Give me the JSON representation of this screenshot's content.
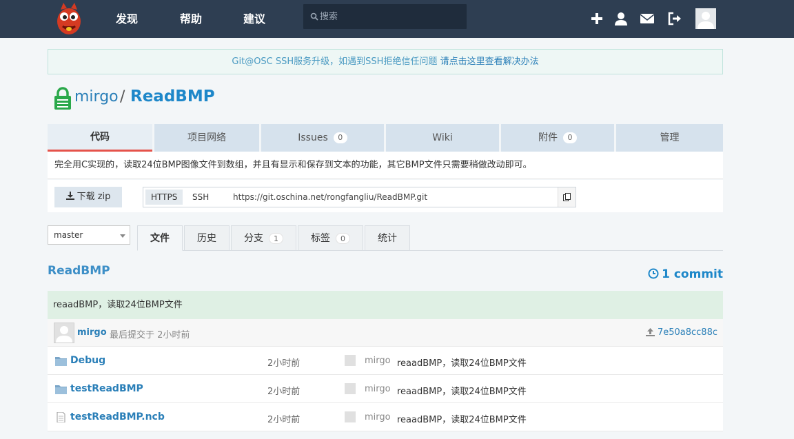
{
  "nav": {
    "links": [
      "发现",
      "帮助",
      "建议"
    ],
    "search_placeholder": "搜索",
    "icons": [
      "plus-icon",
      "user-icon",
      "envelope-icon",
      "logout-icon"
    ]
  },
  "notice": {
    "text": "Git@OSC SSH服务升级，如遇到SSH拒绝信任问题 ",
    "link": "请点击这里查看解决办法"
  },
  "repo": {
    "owner": "mirgo",
    "separator": "/",
    "name": "ReadBMP"
  },
  "tabs": [
    {
      "label": "代码",
      "active": true
    },
    {
      "label": "项目网络"
    },
    {
      "label": "Issues",
      "count": "0"
    },
    {
      "label": "Wiki"
    },
    {
      "label": "附件",
      "count": "0"
    },
    {
      "label": "管理"
    }
  ],
  "description": "完全用C实现的，读取24位BMP图像文件到数组，并且有显示和保存到文本的功能，其它BMP文件只需要稍做改动即可。",
  "download": {
    "label": "下载 zip"
  },
  "clone": {
    "https_label": "HTTPS",
    "ssh_label": "SSH",
    "url": "https://git.oschina.net/rongfangliu/ReadBMP.git"
  },
  "branch": {
    "selected": "master"
  },
  "file_tabs": [
    {
      "label": "文件",
      "active": true
    },
    {
      "label": "历史"
    },
    {
      "label": "分支",
      "count": "1"
    },
    {
      "label": "标签",
      "count": "0"
    },
    {
      "label": "统计"
    }
  ],
  "section": {
    "title": "ReadBMP",
    "commits": "1 commit"
  },
  "last_commit": {
    "message": "reaadBMP，读取24位BMP文件",
    "author": "mirgo",
    "time": "最后提交于 2小时前",
    "sha": "7e50a8cc88c"
  },
  "files": [
    {
      "name": "Debug",
      "type": "folder",
      "time": "2小时前",
      "author": "mirgo",
      "message": "reaadBMP，读取24位BMP文件"
    },
    {
      "name": "testReadBMP",
      "type": "folder",
      "time": "2小时前",
      "author": "mirgo",
      "message": "reaadBMP，读取24位BMP文件"
    },
    {
      "name": "testReadBMP.ncb",
      "type": "file",
      "time": "2小时前",
      "author": "mirgo",
      "message": "reaadBMP，读取24位BMP文件"
    }
  ],
  "colors": {
    "nav_bg": "#2e3e52",
    "link": "#2a7fb8",
    "active_tab_border": "#e5534b",
    "commit_bg": "#dff0e4"
  }
}
